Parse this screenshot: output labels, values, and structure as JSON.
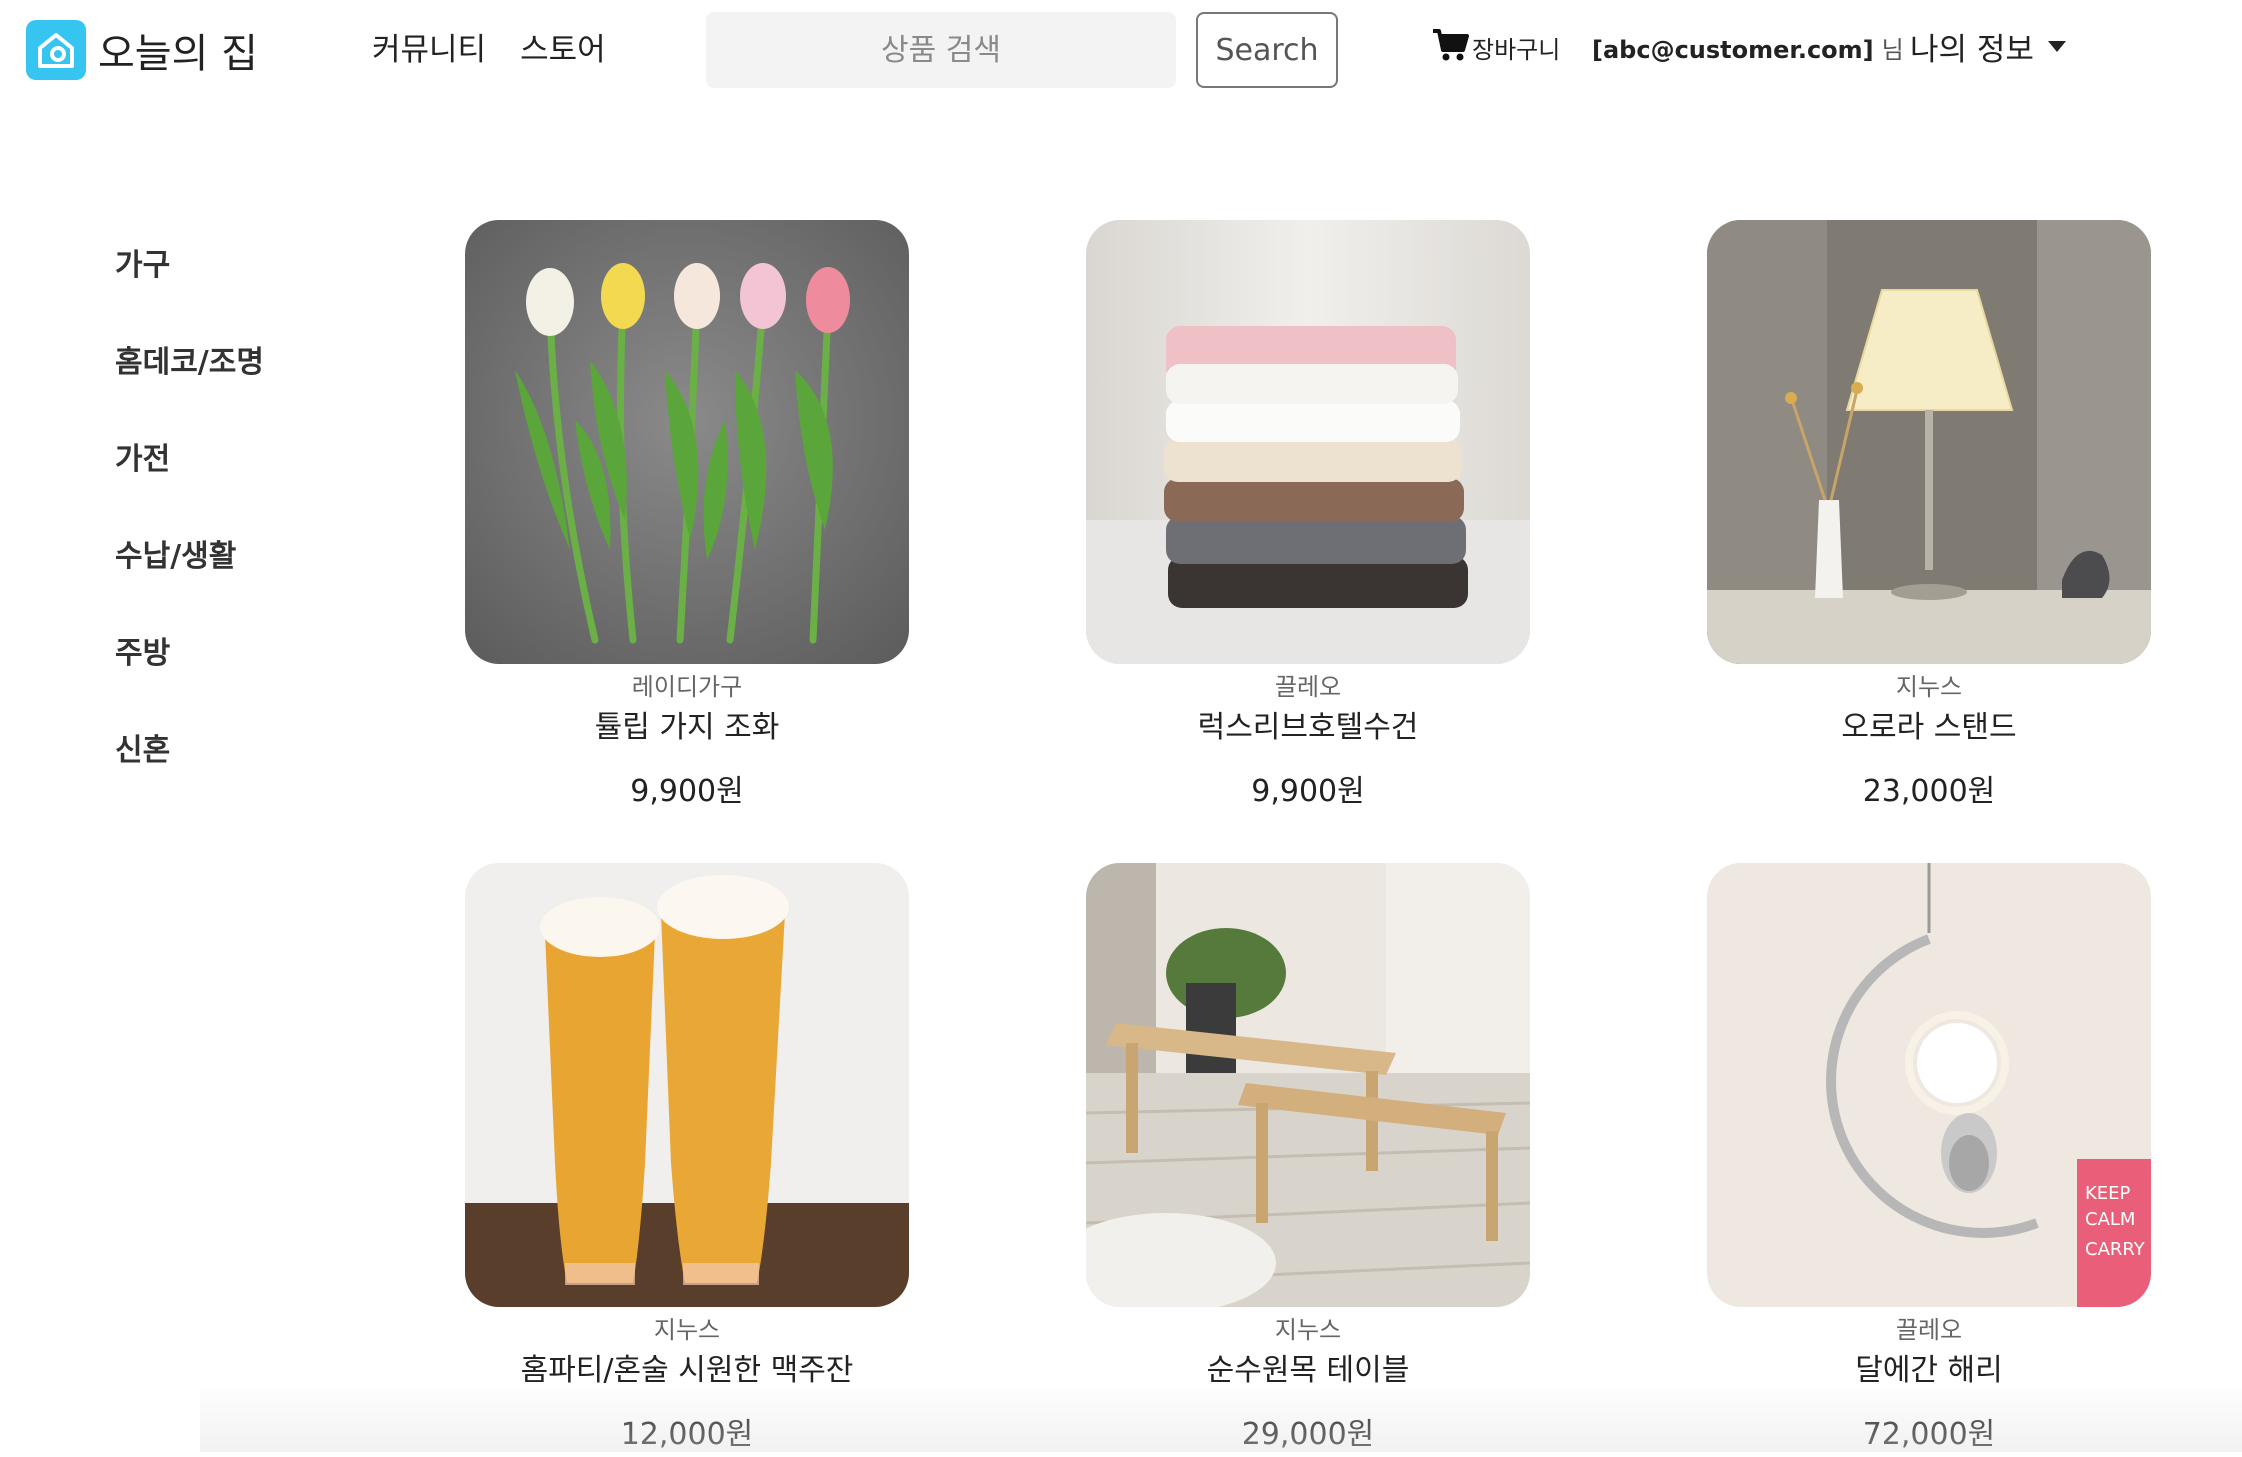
{
  "header": {
    "logo_text": "오늘의 집",
    "nav": [
      "커뮤니티",
      "스토어"
    ],
    "search": {
      "placeholder": "상품 검색",
      "button_label": "Search"
    },
    "cart_label": "장바구니",
    "user_email": "[abc@customer.com]",
    "user_suffix": "님",
    "my_info_label": "나의 정보"
  },
  "sidebar": {
    "items": [
      "가구",
      "홈데코/조명",
      "가전",
      "수납/생활",
      "주방",
      "신혼"
    ]
  },
  "products": [
    {
      "brand": "레이디가구",
      "name": "튤립 가지 조화",
      "price": "9,900원"
    },
    {
      "brand": "끌레오",
      "name": "럭스리브호텔수건",
      "price": "9,900원"
    },
    {
      "brand": "지누스",
      "name": "오로라 스탠드",
      "price": "23,000원"
    },
    {
      "brand": "지누스",
      "name": "홈파티/혼술 시원한 맥주잔",
      "price": "12,000원"
    },
    {
      "brand": "지누스",
      "name": "순수원목 테이블",
      "price": "29,000원"
    },
    {
      "brand": "끌레오",
      "name": "달에간 해리",
      "price": "72,000원"
    }
  ],
  "colors": {
    "brand": "#35c5f0"
  }
}
